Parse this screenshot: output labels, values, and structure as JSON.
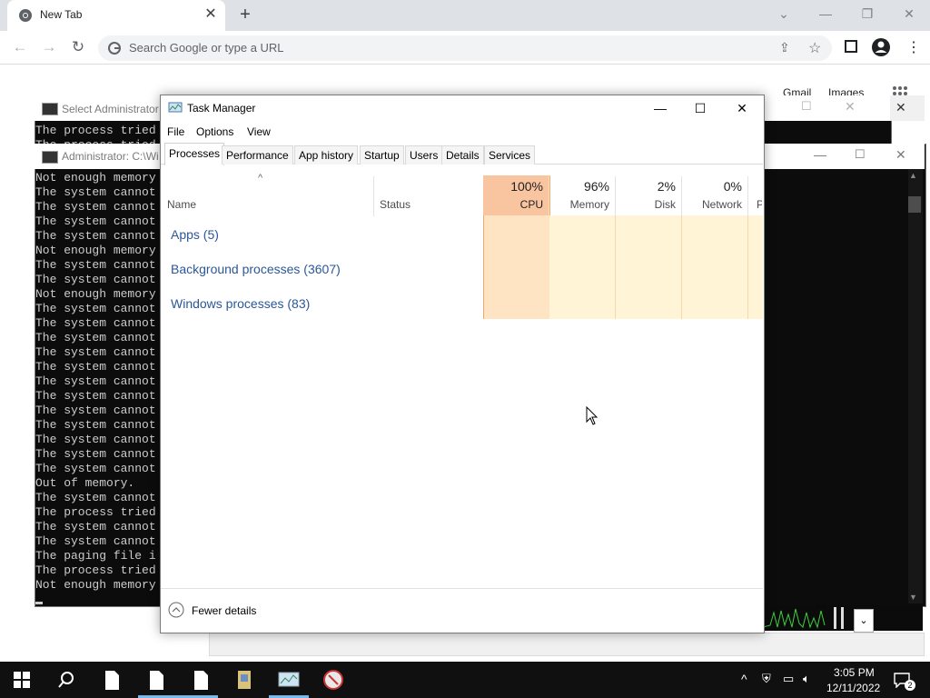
{
  "chrome": {
    "tab_title": "New Tab",
    "omnibox_placeholder": "Search Google or type a URL",
    "new_tab_symbol": "+",
    "tab_close_symbol": "✕"
  },
  "google_links": {
    "gmail": "Gmail",
    "images": "Images"
  },
  "cmd_windows": {
    "back_title": "Select Administrator",
    "front_title": "Administrator: C:\\Wi",
    "back_lines": [
      "The process tried",
      "The process tried"
    ],
    "lines": [
      "Not enough memory",
      "The system cannot",
      "The system cannot",
      "The system cannot",
      "The system cannot",
      "Not enough memory",
      "The system cannot",
      "The system cannot",
      "Not enough memory",
      "The system cannot",
      "The system cannot",
      "The system cannot",
      "The system cannot",
      "The system cannot",
      "The system cannot",
      "The system cannot",
      "The system cannot",
      "The system cannot",
      "The system cannot",
      "The system cannot",
      "The system cannot",
      "Out of memory.",
      "The system cannot",
      "The process tried",
      "The system cannot",
      "The system cannot",
      "The paging file i",
      "The process tried",
      "Not enough memory"
    ]
  },
  "task_manager": {
    "title": "Task Manager",
    "menu": [
      "File",
      "Options",
      "View"
    ],
    "tabs": [
      "Processes",
      "Performance",
      "App history",
      "Startup",
      "Users",
      "Details",
      "Services"
    ],
    "active_tab": "Processes",
    "columns": {
      "name": "Name",
      "status": "Status",
      "cpu": {
        "pct": "100%",
        "label": "CPU"
      },
      "memory": {
        "pct": "96%",
        "label": "Memory"
      },
      "disk": {
        "pct": "2%",
        "label": "Disk"
      },
      "network": {
        "pct": "0%",
        "label": "Network"
      },
      "power_partial": "P"
    },
    "groups": [
      "Apps (5)",
      "Background processes (3607)",
      "Windows processes (83)"
    ],
    "fewer_details": "Fewer details"
  },
  "taskbar": {
    "time": "3:05 PM",
    "date": "12/11/2022",
    "notification_count": "2"
  },
  "colors": {
    "cpu_heat": "#f9c4a0",
    "cell_heat": "#fff4d6",
    "group_text": "#2b5797",
    "taskbar": "#101010"
  }
}
